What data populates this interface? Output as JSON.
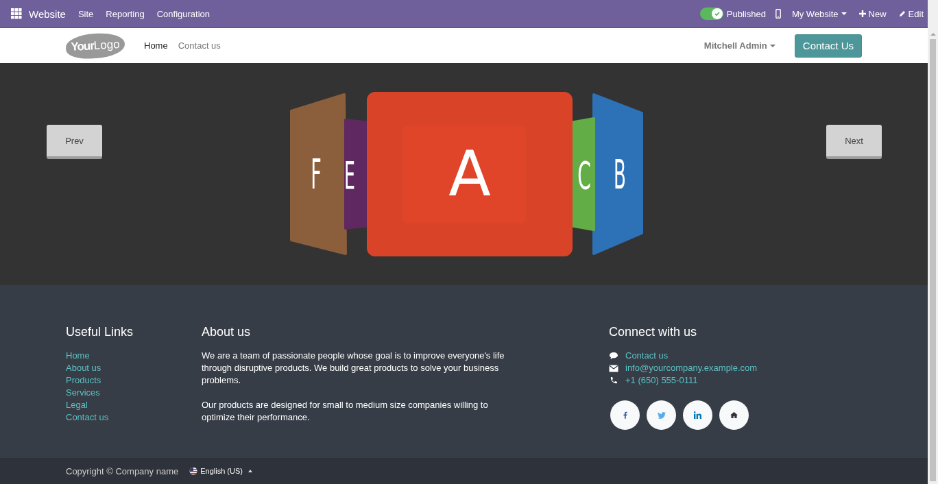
{
  "topbar": {
    "app": "Website",
    "menu": [
      "Site",
      "Reporting",
      "Configuration"
    ],
    "published": {
      "on": true,
      "label": "Published"
    },
    "website": "My Website",
    "new": "New",
    "edit": "Edit"
  },
  "header": {
    "logo_a": "Your",
    "logo_b": "Logo",
    "nav": [
      {
        "label": "Home",
        "selected": true
      },
      {
        "label": "Contact us",
        "selected": false
      }
    ],
    "user": "Mitchell Admin",
    "cta": "Contact Us"
  },
  "carousel": {
    "prev": "Prev",
    "next": "Next",
    "slides": [
      {
        "letter": "F",
        "kind": "far-left",
        "color": "#8b5e3c"
      },
      {
        "letter": "E",
        "kind": "near-left",
        "color": "#5f2860"
      },
      {
        "letter": "A",
        "kind": "front",
        "color": "#d94327"
      },
      {
        "letter": "C",
        "kind": "near-right",
        "color": "#63ad47"
      },
      {
        "letter": "B",
        "kind": "far-right",
        "color": "#2d72b6"
      }
    ]
  },
  "footer": {
    "links_title": "Useful Links",
    "links": [
      "Home",
      "About us",
      "Products",
      "Services",
      "Legal",
      "Contact us"
    ],
    "about_title": "About us",
    "about": [
      "We are a team of passionate people whose goal is to improve everyone's life through disruptive products. We build great products to solve your business problems.",
      "Our products are designed for small to medium size companies willing to optimize their performance."
    ],
    "connect_title": "Connect with us",
    "contacts": [
      {
        "kind": "chat",
        "text": "Contact us"
      },
      {
        "kind": "mail",
        "text": "info@yourcompany.example.com"
      },
      {
        "kind": "phone",
        "text": "+1 (650) 555-0111"
      }
    ],
    "social": [
      {
        "kind": "facebook"
      },
      {
        "kind": "twitter"
      },
      {
        "kind": "linkedin"
      },
      {
        "kind": "home"
      }
    ]
  },
  "bottom": {
    "copyright": "Copyright © Company name",
    "language": "English (US)"
  }
}
